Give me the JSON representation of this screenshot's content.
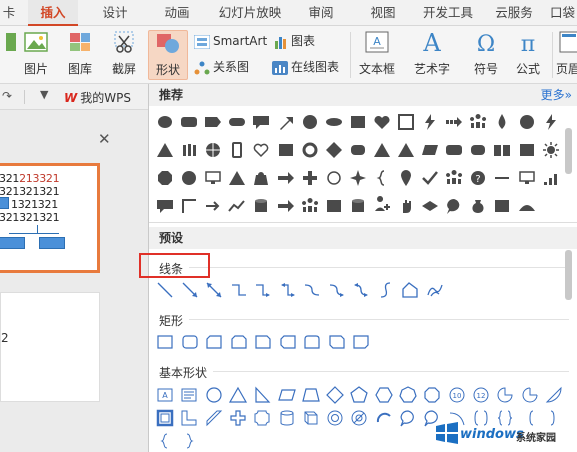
{
  "tabs": [
    "卡",
    "插入",
    "设计",
    "动画",
    "幻灯片放映",
    "审阅",
    "视图",
    "开发工具",
    "云服务",
    "口袋"
  ],
  "active_tab": "插入",
  "ribbon": {
    "picture": "图片",
    "gallery": "图库",
    "screenshot": "截屏",
    "shapes": "形状",
    "smartart": "SmartArt",
    "chart": "图表",
    "relation": "关系图",
    "online_chart": "在线图表",
    "textbox": "文本框",
    "wordart": "艺术字",
    "symbol": "符号",
    "formula": "公式",
    "header": "页眉"
  },
  "quickbar": {
    "mywps": "我的WPS"
  },
  "slide1": {
    "line1_a": "321",
    "line1_b": "213321",
    "line2": "321321321",
    "line3": "1321321",
    "line4": "321321321"
  },
  "slide2": {
    "number": "2"
  },
  "dropdown": {
    "recommended": "推荐",
    "more": "更多»",
    "presets": "预设",
    "lines": "线条",
    "rectangles": "矩形",
    "basic_shapes": "基本形状"
  },
  "colors": {
    "accent": "#d24726",
    "shape_gray": "#4a4a4a",
    "outline_blue": "#3a6fbf",
    "highlight_red": "#e03028"
  },
  "watermark": {
    "brand": "windows",
    "site": "系统家园"
  }
}
